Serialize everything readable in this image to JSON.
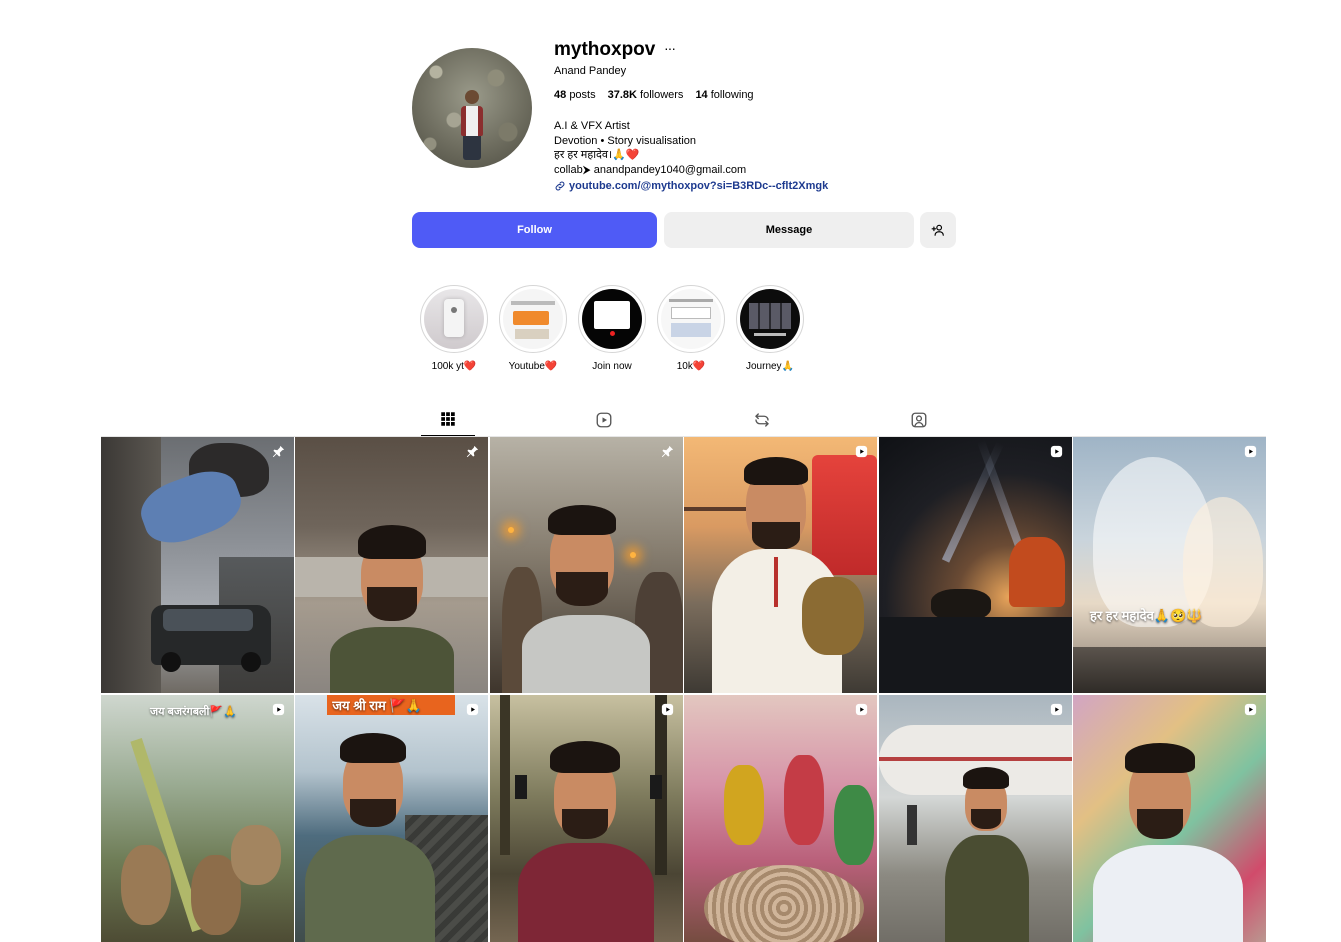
{
  "profile": {
    "username": "mythoxpov",
    "more": "···",
    "full_name": "Anand Pandey",
    "posts_count": "48",
    "posts_label": "posts",
    "followers_count": "37.8K",
    "followers_label": "followers",
    "following_count": "14",
    "following_label": "following",
    "bio": [
      "A.I & VFX Artist",
      "Devotion • Story visualisation",
      "हर हर महादेव।🙏❤️",
      "collab⮞ anandpandey1040@gmail.com"
    ],
    "link": "youtube.com/@mythoxpov?si=B3RDc--cflt2Xmgk"
  },
  "actions": {
    "follow": "Follow",
    "message": "Message",
    "add_user_icon": "add-user-icon"
  },
  "highlights": [
    {
      "label": "100k yt❤️"
    },
    {
      "label": "Youtube❤️"
    },
    {
      "label": "Join now"
    },
    {
      "label": "10k❤️"
    },
    {
      "label": "Journey🙏"
    }
  ],
  "tabs": [
    {
      "name": "posts",
      "icon": "grid-icon",
      "active": true
    },
    {
      "name": "reels",
      "icon": "reels-icon",
      "active": false
    },
    {
      "name": "reposts",
      "icon": "repost-icon",
      "active": false
    },
    {
      "name": "tagged",
      "icon": "tagged-icon",
      "active": false
    }
  ],
  "posts": [
    {
      "badge": "pin",
      "overlay": ""
    },
    {
      "badge": "pin",
      "overlay": ""
    },
    {
      "badge": "pin",
      "overlay": ""
    },
    {
      "badge": "reel",
      "overlay": ""
    },
    {
      "badge": "reel",
      "overlay": ""
    },
    {
      "badge": "reel",
      "overlay": "हर हर महादेव🙏🥺🔱"
    },
    {
      "badge": "reel",
      "overlay": "जय बजरंगबली🚩🙏"
    },
    {
      "badge": "reel",
      "overlay": "जय श्री राम 🚩🙏"
    },
    {
      "badge": "reel",
      "overlay": ""
    },
    {
      "badge": "reel",
      "overlay": ""
    },
    {
      "badge": "reel",
      "overlay": ""
    },
    {
      "badge": "reel",
      "overlay": ""
    }
  ],
  "colors": {
    "follow_button": "#4f5bf6",
    "secondary_button": "#efefef",
    "link": "#1d3a8f"
  }
}
